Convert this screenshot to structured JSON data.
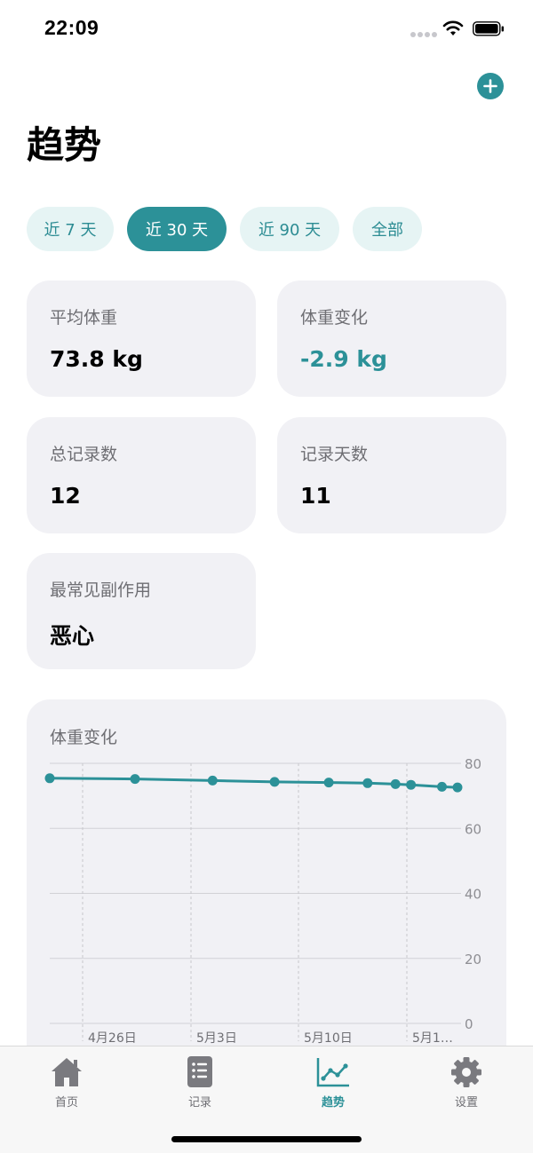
{
  "status_bar": {
    "time": "22:09"
  },
  "header": {
    "title": "趋势",
    "add_icon": "plus-icon"
  },
  "filters": [
    {
      "label": "近 7 天",
      "active": false
    },
    {
      "label": "近 30 天",
      "active": true
    },
    {
      "label": "近 90 天",
      "active": false
    },
    {
      "label": "全部",
      "active": false
    }
  ],
  "stats": {
    "avg_weight": {
      "label": "平均体重",
      "value": "73.8 kg"
    },
    "weight_change": {
      "label": "体重变化",
      "value": "-2.9 kg"
    },
    "total_records": {
      "label": "总记录数",
      "value": "12"
    },
    "record_days": {
      "label": "记录天数",
      "value": "11"
    },
    "common_side_effect": {
      "label": "最常见副作用",
      "value": "恶心"
    }
  },
  "chart_card": {
    "title": "体重变化"
  },
  "chart_data": {
    "type": "line",
    "title": "体重变化",
    "xlabel": "",
    "ylabel": "",
    "ylim": [
      0,
      80
    ],
    "yticks": [
      "80",
      "60",
      "40",
      "20",
      "0"
    ],
    "xtick_labels": [
      "4月26日",
      "5月3日",
      "5月10日",
      "5月1…"
    ],
    "grid": true,
    "series": [
      {
        "values": [
          75.4,
          75.2,
          74.7,
          74.3,
          74.1,
          73.9,
          73.6,
          73.4,
          72.8,
          72.6
        ],
        "day_offsets": [
          0,
          5.5,
          10.5,
          14.5,
          18,
          20.5,
          22.3,
          23.3,
          25.3,
          26.3
        ]
      }
    ],
    "color": "#2c9198"
  },
  "tabs": [
    {
      "label": "首页",
      "icon": "house-icon",
      "active": false
    },
    {
      "label": "记录",
      "icon": "list-icon",
      "active": false
    },
    {
      "label": "趋势",
      "icon": "trend-chart-icon",
      "active": true
    },
    {
      "label": "设置",
      "icon": "gear-icon",
      "active": false
    }
  ]
}
